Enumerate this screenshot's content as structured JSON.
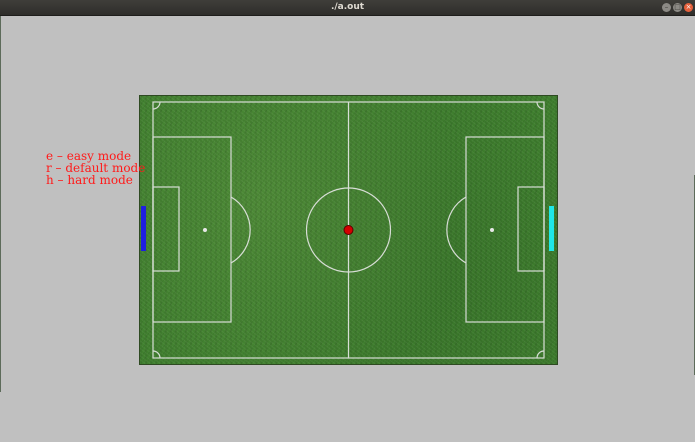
{
  "window": {
    "title": "./a.out",
    "buttons": {
      "minimize": "–",
      "maximize": "□",
      "close": "×"
    }
  },
  "controls_help": [
    {
      "label": "e – easy mode"
    },
    {
      "label": "r – default mode"
    },
    {
      "label": "h – hard mode"
    }
  ],
  "colors": {
    "help_text": "#ff1a1a",
    "left_paddle": "#1f1fe0",
    "right_paddle": "#1fe8e8",
    "ball": "#d40000",
    "field_lines": "#e8e8e8",
    "background": "#c0c0c0"
  },
  "icons": [
    "minimize-icon",
    "maximize-icon",
    "close-icon"
  ]
}
